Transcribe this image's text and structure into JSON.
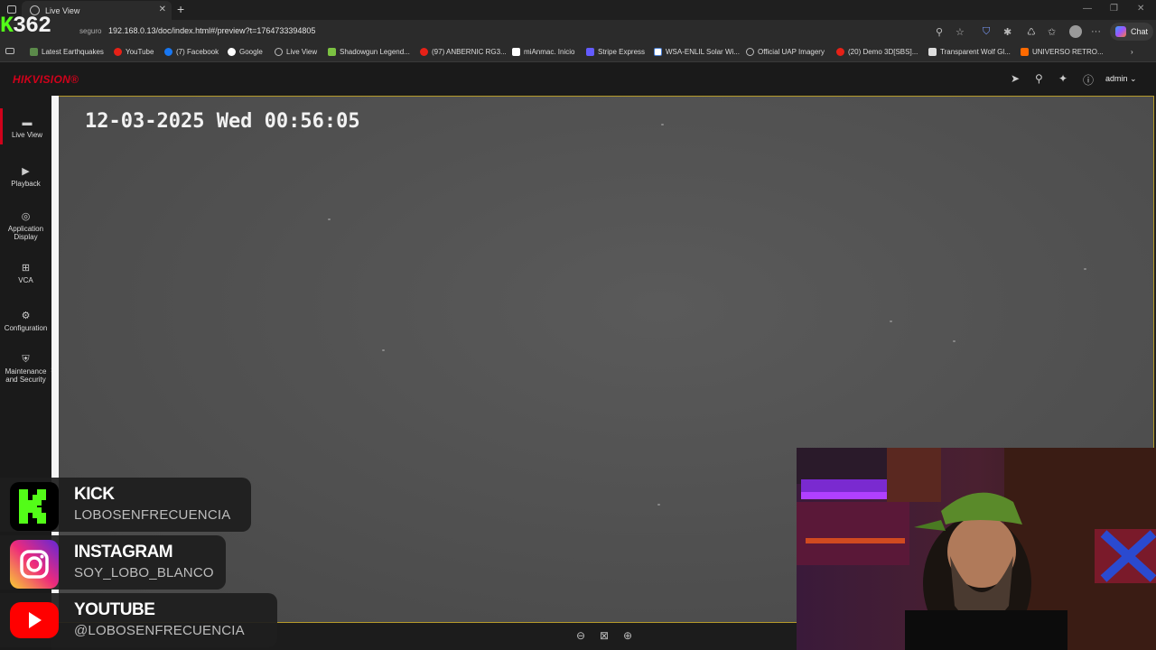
{
  "browser": {
    "tab_title": "Live View",
    "address_security": "seguro",
    "url": "192.168.0.13/doc/index.html#/preview?t=1764733394805",
    "chat_label": "Chat"
  },
  "overlay_counter": {
    "letter": "K",
    "number": "362"
  },
  "bookmarks": [
    "Latest Earthquakes",
    "YouTube",
    "(7) Facebook",
    "Google",
    "Live View",
    "Shadowgun Legend...",
    "(97) ANBERNIC RG3...",
    "miAnmac. Inicio",
    "Stripe Express",
    "WSA-ENLIL Solar Wi...",
    "Official UAP Imagery",
    "(20) Demo 3D[SBS]...",
    "Transparent Wolf Gl...",
    "UNIVERSO RETRO..."
  ],
  "app": {
    "brand": "HIKVISION",
    "user": "admin"
  },
  "nav": {
    "live_view": "Live View",
    "playback": "Playback",
    "application_display_1": "Application",
    "application_display_2": "Display",
    "vca": "VCA",
    "configuration": "Configuration",
    "maintenance_1": "Maintenance",
    "maintenance_2": "and Security"
  },
  "video": {
    "osd_timestamp": "12-03-2025 Wed 00:56:05"
  },
  "social": {
    "kick_title": "KICK",
    "kick_handle": "LOBOSENFRECUENCIA",
    "instagram_title": "INSTAGRAM",
    "instagram_handle": "SOY_LOBO_BLANCO",
    "youtube_title": "YOUTUBE",
    "youtube_handle": "@LOBOSENFRECUENCIA"
  },
  "colors": {
    "kick_green": "#53fc18",
    "hikvision_red": "#d0021b",
    "video_border": "#b59a2a"
  }
}
